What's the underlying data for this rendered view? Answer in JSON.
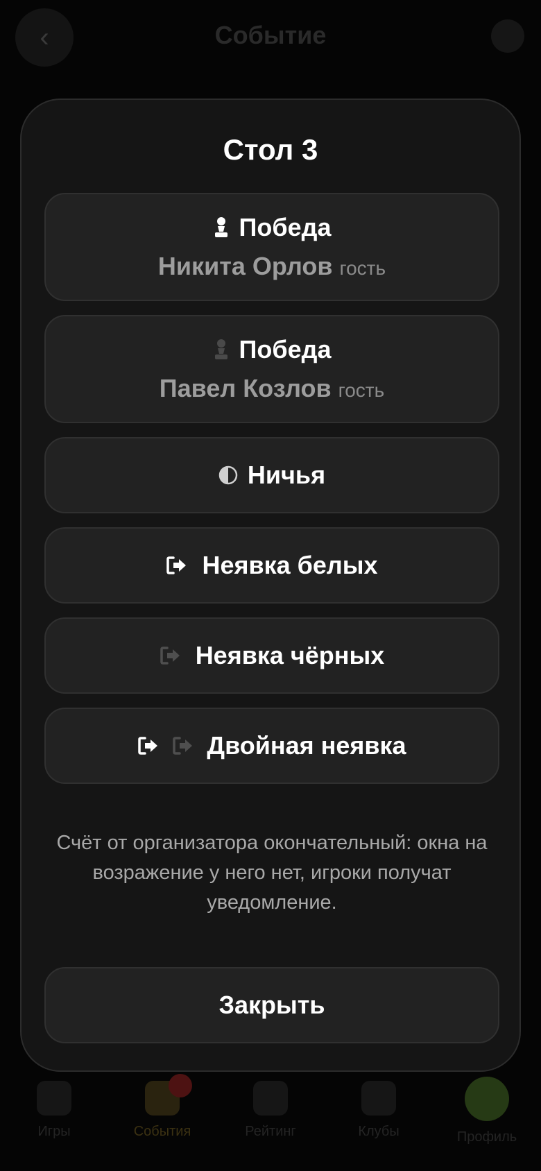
{
  "background": {
    "title": "Событие",
    "tabs": [
      {
        "label": "Игры",
        "icon": "pawn-icon"
      },
      {
        "label": "События",
        "icon": "trophy-icon",
        "badge": "",
        "active": true
      },
      {
        "label": "Рейтинг",
        "icon": "chart-icon"
      },
      {
        "label": "Клубы",
        "icon": "club-icon"
      },
      {
        "label": "Профиль",
        "icon": "avatar-icon"
      }
    ]
  },
  "modal": {
    "title": "Стол 3",
    "options": {
      "white_win": {
        "label": "Победа",
        "player": "Никита Орлов",
        "tag": "гость",
        "icon": "white-pawn-icon"
      },
      "black_win": {
        "label": "Победа",
        "player": "Павел Козлов",
        "tag": "гость",
        "icon": "black-pawn-icon"
      },
      "draw": {
        "label": "Ничья",
        "icon": "half-circle-icon"
      },
      "white_forfeit": {
        "label": "Неявка белых",
        "icon": "exit-icon"
      },
      "black_forfeit": {
        "label": "Неявка чёрных",
        "icon": "exit-icon"
      },
      "double_forfeit": {
        "label": "Двойная неявка",
        "icon": "exit-icon"
      }
    },
    "note": "Счёт от организатора окончательный: окна на возражение у него нет, игроки получат уведомление.",
    "close_label": "Закрыть"
  },
  "colors": {
    "modal_bg": "#151515",
    "button_bg": "#222222",
    "text_primary": "#ffffff",
    "text_secondary": "#a9a9a9",
    "icon_dim": "#5a5a5a"
  }
}
